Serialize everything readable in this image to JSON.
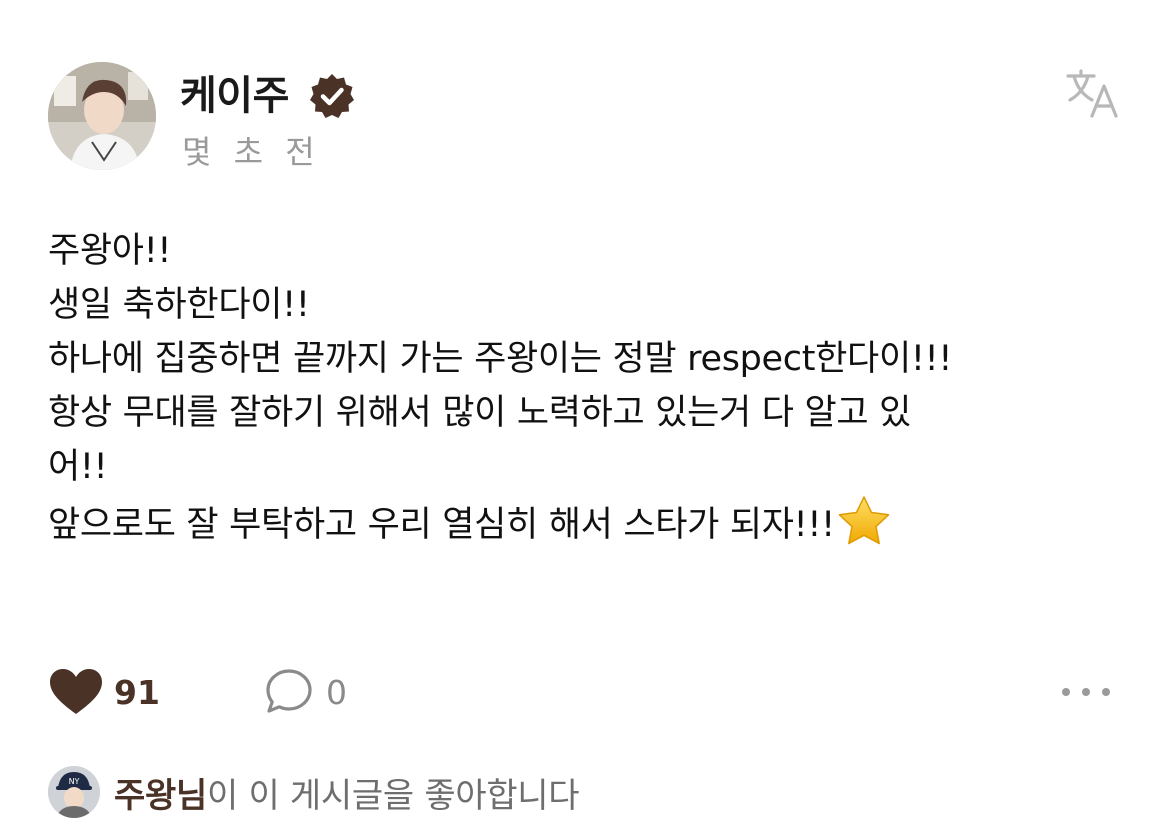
{
  "post": {
    "author": {
      "name": "케이주",
      "verified": true,
      "avatar": "author-avatar-photo"
    },
    "timestamp": "몇 초 전",
    "translate_icon": "translate-icon",
    "body_lines": [
      "주왕아!!",
      "생일 축하한다이!!",
      "하나에 집중하면 끝까지 가는 주왕이는 정말 respect한다이!!!",
      "항상 무대를 잘하기 위해서 많이 노력하고 있는거 다 알고 있",
      "어!!",
      "앞으로도 잘 부탁하고 우리 열심히 해서 스타가 되자!!!"
    ],
    "trailing_emoji": "star-emoji",
    "actions": {
      "like_icon": "heart-filled-icon",
      "like_count": "91",
      "reply_icon": "speech-bubble-icon",
      "reply_count": "0",
      "more_icon": "more-dots-icon"
    },
    "liked_by": {
      "avatar": "liker-avatar-photo",
      "name": "주왕님",
      "suffix": "이 이 게시글을 좋아합니다"
    }
  },
  "colors": {
    "accent_brown": "#4a3226",
    "muted_text": "#9a9a9a",
    "body_text": "#111111",
    "star_gold": "#f5c518"
  }
}
